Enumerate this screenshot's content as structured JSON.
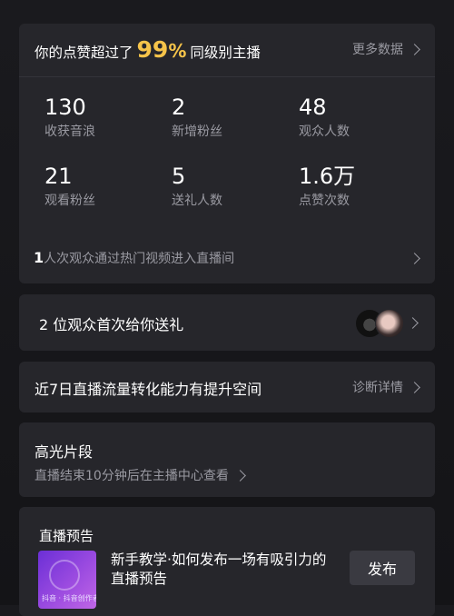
{
  "summary": {
    "prefix": "你的点赞超过了",
    "percent_value": "99",
    "percent_sign": "%",
    "suffix": "同级别主播",
    "more_label": "更多数据"
  },
  "stats": [
    {
      "value": "130",
      "label": "收获音浪"
    },
    {
      "value": "2",
      "label": "新增粉丝"
    },
    {
      "value": "48",
      "label": "观众人数"
    },
    {
      "value": "21",
      "label": "观看粉丝"
    },
    {
      "value": "5",
      "label": "送礼人数"
    },
    {
      "value": "1.6万",
      "label": "点赞次数"
    }
  ],
  "hot_video": {
    "count": "1",
    "text": "人次观众通过热门视频进入直播间"
  },
  "gift": {
    "text": "2 位观众首次给你送礼"
  },
  "flow": {
    "text": "近7日直播流量转化能力有提升空间",
    "action": "诊断详情"
  },
  "highlight": {
    "title": "高光片段",
    "subtitle": "直播结束10分钟后在主播中心查看"
  },
  "preview": {
    "title": "直播预告",
    "thumbnail_caption": "抖音 · 抖音创作者学院",
    "description": "新手教学·如何发布一场有吸引力的直播预告",
    "button": "发布"
  }
}
